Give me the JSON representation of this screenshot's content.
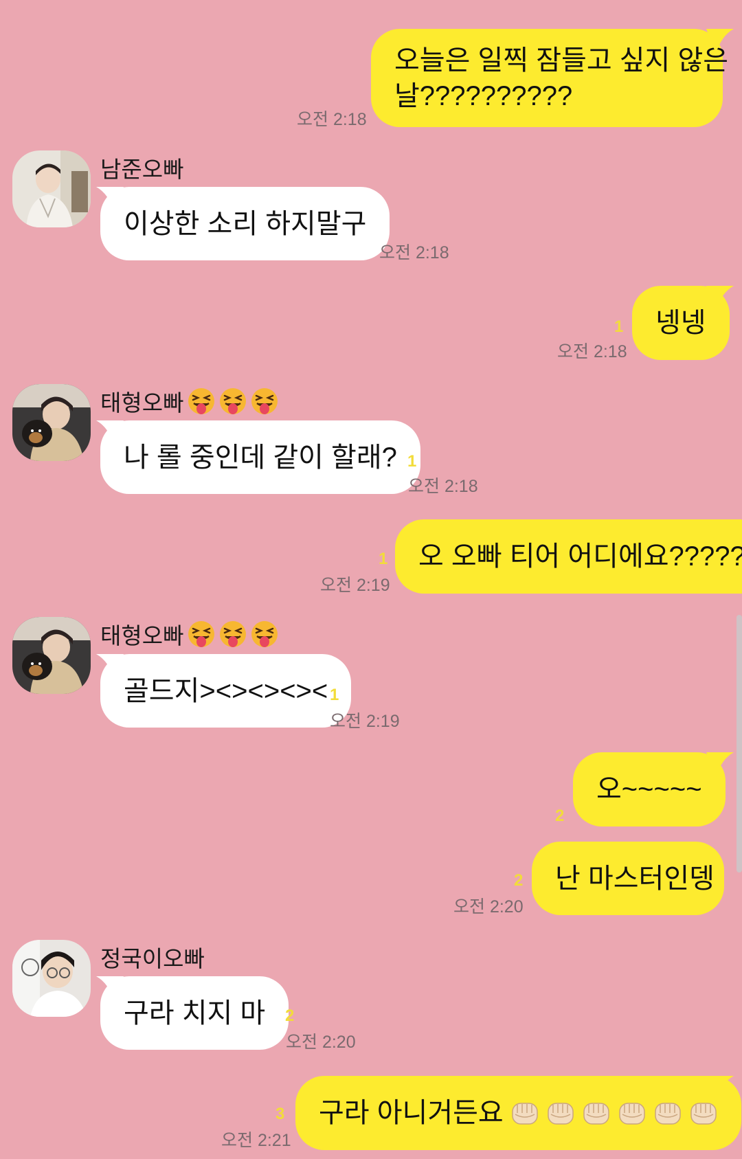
{
  "chat": {
    "m1": {
      "text": "오늘은 일찍 잠들고 싶지 않은 날??????????",
      "line1": "오늘은 일찍 잠들고 싶지 않은",
      "line2": "날??????????",
      "time": "오전 2:18"
    },
    "m2": {
      "sender": "남준오빠",
      "text": "이상한 소리 하지말구",
      "time": "오전 2:18"
    },
    "m3": {
      "text": "넹넹",
      "unread": "1",
      "time": "오전 2:18"
    },
    "m4": {
      "sender": "태형오빠",
      "text": "나 롤 중인데 같이 할래?",
      "unread": "1",
      "time": "오전 2:18"
    },
    "m5": {
      "text": "오 오빠 티어 어디에요?????",
      "unread": "1",
      "time": "오전 2:19"
    },
    "m6": {
      "sender": "태형오빠",
      "text": "골드지><><><><",
      "unread": "1",
      "time": "오전 2:19"
    },
    "m7": {
      "text": "오~~~~~",
      "unread": "2"
    },
    "m8": {
      "text": "난 마스터인뎅",
      "unread": "2",
      "time": "오전 2:20"
    },
    "m9": {
      "sender": "정국이오빠",
      "text": "구라 치지 마",
      "unread": "2",
      "time": "오전 2:20"
    },
    "m10": {
      "text": "구라 아니거든요",
      "unread": "3",
      "time": "오전 2:21"
    }
  },
  "icons": {
    "sender_emoji": "squinting-tongue-face-icon",
    "fist": "oncoming-fist-icon"
  },
  "colors": {
    "background": "#eba7b1",
    "my_bubble": "#fdeb2f",
    "their_bubble": "#ffffff",
    "unread_count": "#f2dc3a",
    "timestamp": "#7a6a6e"
  }
}
